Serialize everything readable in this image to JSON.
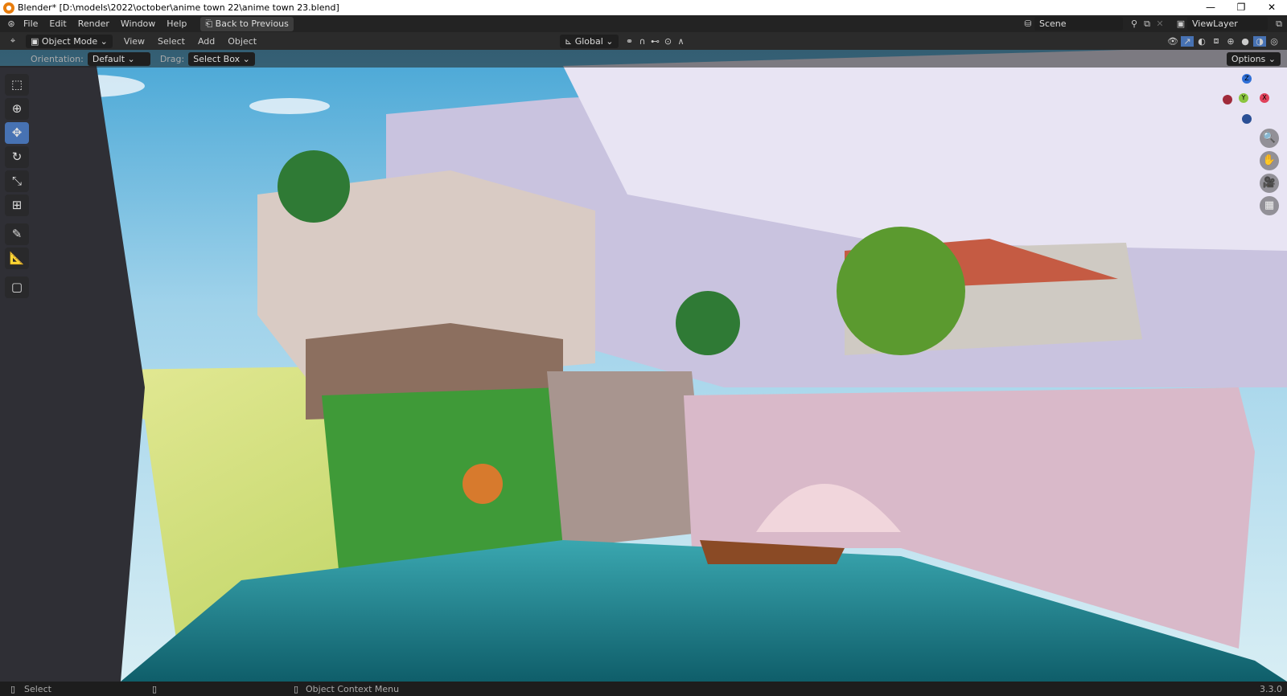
{
  "window": {
    "title": "Blender* [D:\\models\\2022\\october\\anime town 22\\anime town 23.blend]",
    "minimize": "—",
    "restore": "❐",
    "close": "✕"
  },
  "menubar": {
    "items": [
      "File",
      "Edit",
      "Render",
      "Window",
      "Help"
    ],
    "back_button": "Back to Previous",
    "scene": "Scene",
    "view_layer": "ViewLayer"
  },
  "header": {
    "mode": "Object Mode",
    "menus": [
      "View",
      "Select",
      "Add",
      "Object"
    ],
    "transform_orientation": "Global"
  },
  "tool_settings": {
    "orientation_label": "Orientation:",
    "orientation_value": "Default",
    "drag_label": "Drag:",
    "drag_value": "Select Box",
    "options": "Options"
  },
  "toolbar": {
    "tools": [
      "select-box",
      "cursor",
      "move",
      "rotate",
      "scale",
      "transform",
      "annotate",
      "measure",
      "add-cube"
    ],
    "active": "move"
  },
  "gizmo": {
    "axes": [
      "X",
      "Y",
      "Z"
    ]
  },
  "statusbar": {
    "left_action": "Select",
    "right_action": "Object Context Menu",
    "version": "3.3.0"
  }
}
